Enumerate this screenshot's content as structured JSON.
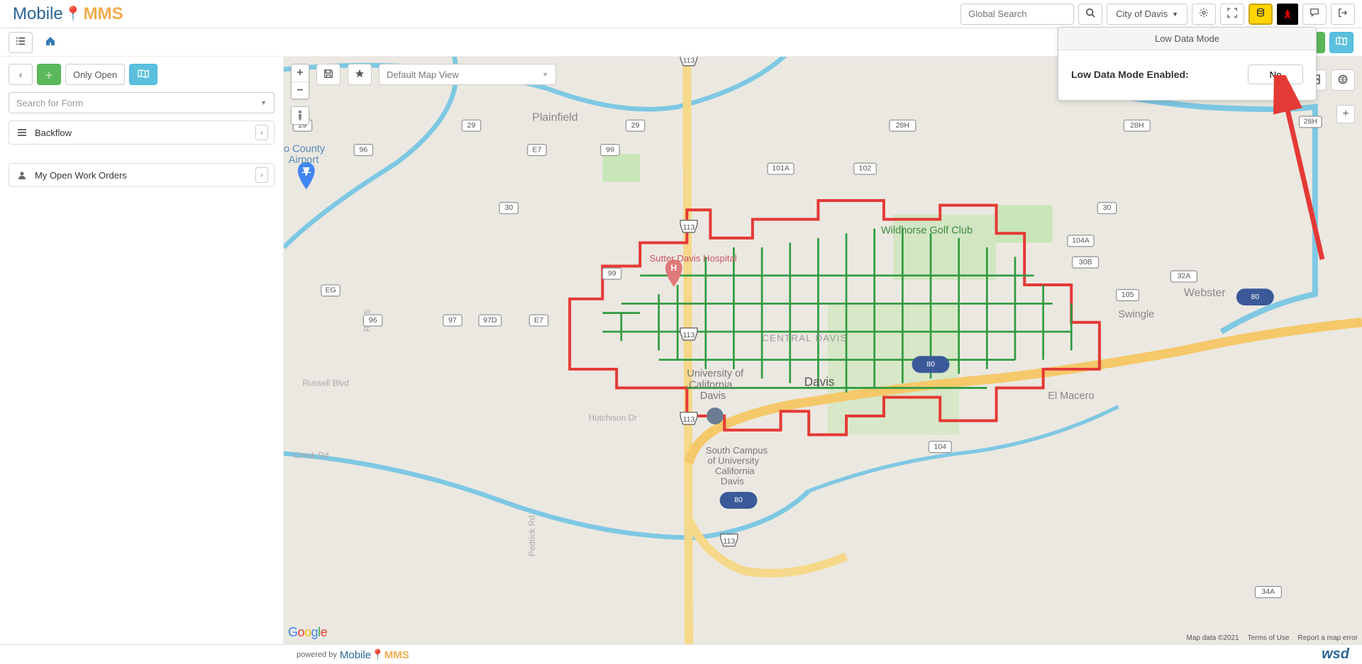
{
  "header": {
    "search_placeholder": "Global Search",
    "city_label": "City of Davis"
  },
  "popover": {
    "title": "Low Data Mode",
    "label": "Low Data Mode Enabled:",
    "button": "No"
  },
  "sidebar": {
    "only_open": "Only Open",
    "search_form_placeholder": "Search for Form",
    "items": [
      {
        "label": "Backflow",
        "icon": "list"
      },
      {
        "label": "My Open Work Orders",
        "icon": "user"
      }
    ]
  },
  "map": {
    "view_select": "Default Map View",
    "labels": {
      "plainfield": "Plainfield",
      "airport_l1": "o County",
      "airport_l2": "Airport",
      "wildhorse": "Wildhorse Golf Club",
      "hospital": "Sutter Davis Hospital",
      "central": "CENTRAL DAVIS",
      "uc_l1": "University of",
      "uc_l2": "California,",
      "uc_l3": "Davis",
      "davis": "Davis",
      "south_l1": "South Campus",
      "south_l2": "of University",
      "south_l3": "California",
      "south_l4": "Davis",
      "webster": "Webster",
      "swingle": "Swingle",
      "elmacero": "El Macero",
      "russell": "Russell Blvd",
      "hutchison": "Hutchison Dr",
      "creek": "Creek Rd",
      "pedrick": "Pedrick Rd",
      "rd95": "Rd 95"
    },
    "google": "Google",
    "attribution": {
      "data": "Map data ©2021",
      "terms": "Terms of Use",
      "report": "Report a map error"
    }
  },
  "footer": {
    "powered_by": "powered by"
  }
}
